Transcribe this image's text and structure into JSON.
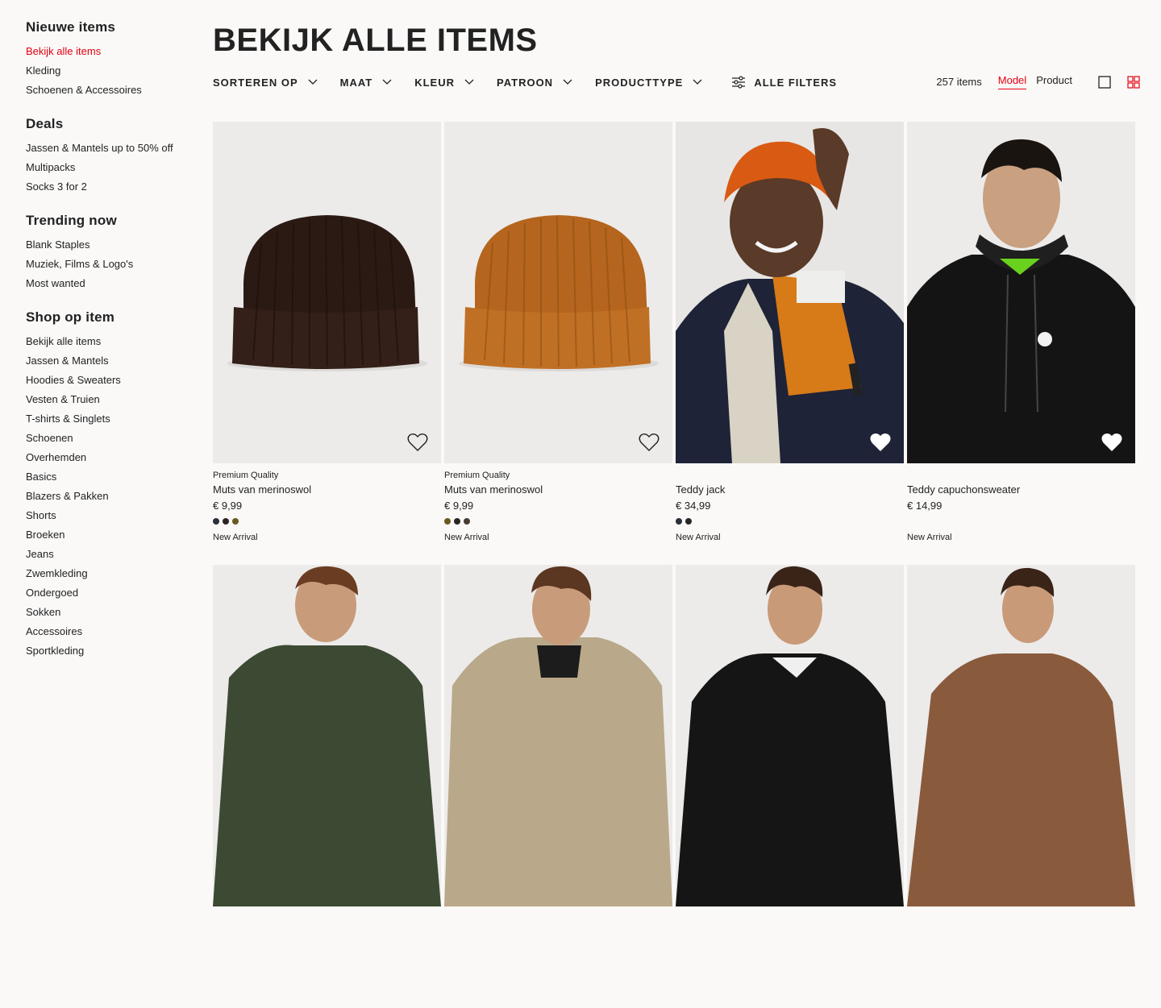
{
  "sidebar": {
    "sections": [
      {
        "heading": "Nieuwe items",
        "items": [
          "Bekijk alle items",
          "Kleding",
          "Schoenen & Accessoires"
        ]
      },
      {
        "heading": "Deals",
        "items": [
          "Jassen & Mantels up to 50% off",
          "Multipacks",
          "Socks 3 for 2"
        ]
      },
      {
        "heading": "Trending now",
        "items": [
          "Blank Staples",
          "Muziek, Films & Logo's",
          "Most wanted"
        ]
      },
      {
        "heading": "Shop op item",
        "items": [
          "Bekijk alle items",
          "Jassen & Mantels",
          "Hoodies & Sweaters",
          "Vesten & Truien",
          "T-shirts & Singlets",
          "Schoenen",
          "Overhemden",
          "Basics",
          "Blazers & Pakken",
          "Shorts",
          "Broeken",
          "Jeans",
          "Zwemkleding",
          "Ondergoed",
          "Sokken",
          "Accessoires",
          "Sportkleding"
        ]
      }
    ],
    "active_item": "Bekijk alle items"
  },
  "page_title": "BEKIJK ALLE ITEMS",
  "filters": {
    "sort": "SORTEREN OP",
    "size": "MAAT",
    "color": "KLEUR",
    "pattern": "PATROON",
    "product_type": "PRODUCTTYPE",
    "all_filters": "ALLE FILTERS"
  },
  "result_count": "257 items",
  "view_modes": {
    "model": "Model",
    "product": "Product",
    "active": "Model"
  },
  "colors": {
    "accent": "#e50010",
    "text": "#222222",
    "background": "#faf9f8",
    "image_bg": "#ecebea"
  },
  "products": [
    {
      "tag": "Premium Quality",
      "name": "Muts van merinoswol",
      "price": "€ 9,99",
      "swatches": [
        "#2b2f3a",
        "#2a2522",
        "#6b5a1e"
      ],
      "badge": "New Arrival",
      "image": "brown-beanie"
    },
    {
      "tag": "Premium Quality",
      "name": "Muts van merinoswol",
      "price": "€ 9,99",
      "swatches": [
        "#6b5a1e",
        "#2a2522",
        "#4a3a34"
      ],
      "badge": "New Arrival",
      "image": "orange-beanie"
    },
    {
      "tag": "",
      "name": "Teddy jack",
      "price": "€ 34,99",
      "swatches": [
        "#2b2f3a",
        "#2a2522"
      ],
      "badge": "New Arrival",
      "image": "model-teddy-jacket"
    },
    {
      "tag": "",
      "name": "Teddy capuchonsweater",
      "price": "€ 14,99",
      "swatches": [],
      "badge": "New Arrival",
      "image": "model-black-hoodie"
    },
    {
      "tag": "",
      "name": "",
      "price": "",
      "swatches": [],
      "badge": "",
      "image": "model-green-parka"
    },
    {
      "tag": "",
      "name": "",
      "price": "",
      "swatches": [],
      "badge": "",
      "image": "model-beige-parka"
    },
    {
      "tag": "",
      "name": "",
      "price": "",
      "swatches": [],
      "badge": "",
      "image": "model-black-hoodie-2"
    },
    {
      "tag": "",
      "name": "",
      "price": "",
      "swatches": [],
      "badge": "",
      "image": "model-brown-sweater"
    }
  ]
}
